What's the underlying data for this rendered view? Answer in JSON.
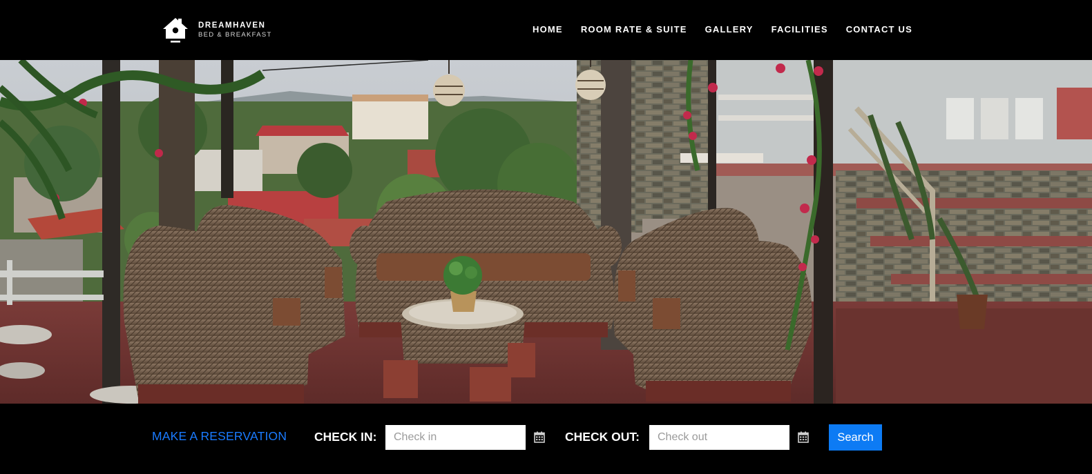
{
  "brand": {
    "name": "DREAMHAVEN",
    "tagline": "BED & BREAKFAST"
  },
  "nav": {
    "items": [
      {
        "label": "HOME"
      },
      {
        "label": "ROOM RATE & SUITE"
      },
      {
        "label": "GALLERY"
      },
      {
        "label": "FACILITIES"
      },
      {
        "label": "CONTACT US"
      }
    ]
  },
  "reservation": {
    "title": "MAKE A RESERVATION",
    "check_in_label": "CHECK IN:",
    "check_in_placeholder": "Check in",
    "check_out_label": "CHECK OUT:",
    "check_out_placeholder": "Check out",
    "search_label": "Search"
  },
  "colors": {
    "accent": "#1a7bff",
    "button": "#0d7bf4",
    "background": "#000000"
  },
  "icons": {
    "logo": "house-icon",
    "date": "calendar-icon"
  }
}
